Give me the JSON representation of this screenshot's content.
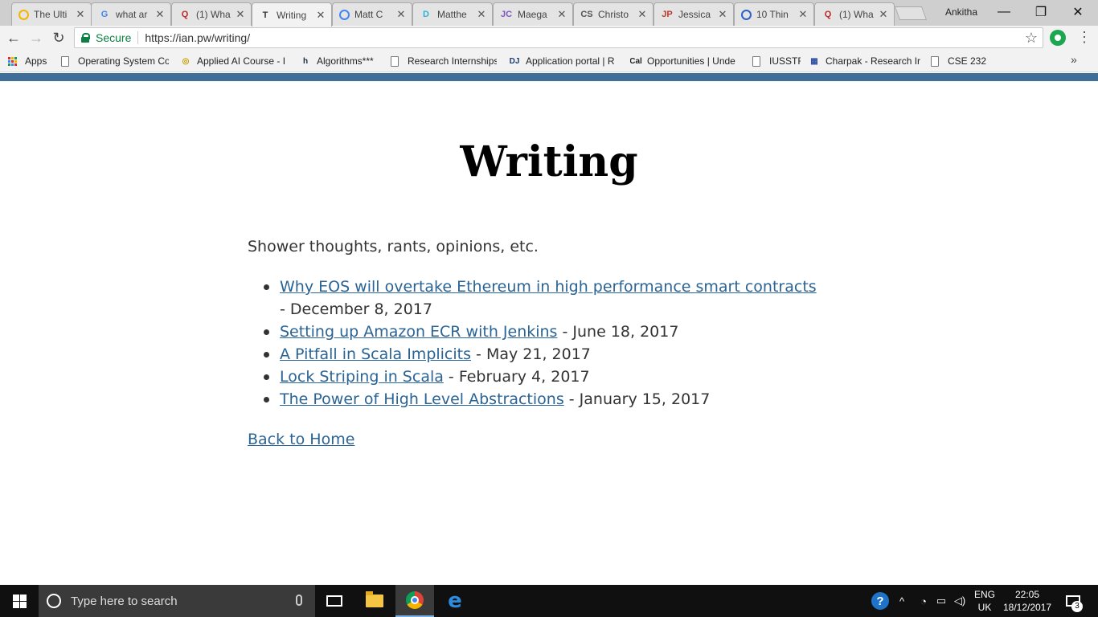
{
  "browser": {
    "tabs": [
      {
        "title": "The Ulti",
        "favicon": "slides-icon",
        "favicon_text": "",
        "favicon_color": "#f4b400"
      },
      {
        "title": "what ar",
        "favicon": "google-icon",
        "favicon_text": "G",
        "favicon_color": "#4285f4"
      },
      {
        "title": "(1) Wha",
        "favicon": "quora-icon",
        "favicon_text": "Q",
        "favicon_color": "#b92b27"
      },
      {
        "title": "Writing",
        "favicon": "writing-icon",
        "favicon_text": "T",
        "favicon_color": "#333333",
        "active": true
      },
      {
        "title": "Matt C",
        "favicon": "loading-icon",
        "favicon_text": "",
        "favicon_color": "#4285f4"
      },
      {
        "title": "Matthe",
        "favicon": "d-icon",
        "favicon_text": "D",
        "favicon_color": "#29b6d6"
      },
      {
        "title": "Maega",
        "favicon": "jc-icon",
        "favicon_text": "JC",
        "favicon_color": "#7e57c2"
      },
      {
        "title": "Christo",
        "favicon": "cs-icon",
        "favicon_text": "CS",
        "favicon_color": "#555555"
      },
      {
        "title": "Jessica",
        "favicon": "jp-icon",
        "favicon_text": "JP",
        "favicon_color": "#c0392b"
      },
      {
        "title": "10 Thin",
        "favicon": "globe-icon",
        "favicon_text": "",
        "favicon_color": "#2a62c9"
      },
      {
        "title": "(1) Wha",
        "favicon": "quora-icon",
        "favicon_text": "Q",
        "favicon_color": "#b92b27"
      }
    ],
    "profile_name": "Ankitha",
    "window_controls": {
      "minimize": "—",
      "restore": "❐",
      "close": "✕"
    },
    "secure_label": "Secure",
    "url": "https://ian.pw/writing/",
    "nav": {
      "back": "←",
      "forward": "→",
      "reload": "↻"
    },
    "star": "☆",
    "menu": "⋮"
  },
  "bookmarks": [
    {
      "label": "Apps",
      "icon": "apps-grid-icon"
    },
    {
      "label": "Operating System Co",
      "icon": "doc-icon"
    },
    {
      "label": "Applied AI Course - I",
      "icon": "course-icon",
      "icon_text": "◎",
      "icon_color": "#c8a000"
    },
    {
      "label": "Algorithms***",
      "icon": "h-icon",
      "icon_text": "h",
      "icon_color": "#1f2a44"
    },
    {
      "label": "Research Internships",
      "icon": "doc-icon"
    },
    {
      "label": "Application portal | R",
      "icon": "dj-icon",
      "icon_text": "DJ",
      "icon_color": "#1b3b6f"
    },
    {
      "label": "Opportunities | Unde",
      "icon": "cal-icon",
      "icon_text": "Cal",
      "icon_color": "#222222"
    },
    {
      "label": "IUSSTF",
      "icon": "doc-icon"
    },
    {
      "label": "Charpak - Research Ir",
      "icon": "charpak-icon",
      "icon_text": "▦",
      "icon_color": "#2d4ea0"
    },
    {
      "label": "CSE 232",
      "icon": "doc-icon"
    }
  ],
  "bookmarks_overflow": "»",
  "page": {
    "title": "Writing",
    "intro": "Shower thoughts, rants, opinions, etc.",
    "posts": [
      {
        "title": "Why EOS will overtake Ethereum in high performance smart contracts",
        "date": " - December 8, 2017"
      },
      {
        "title": "Setting up Amazon ECR with Jenkins",
        "date": " - June 18, 2017"
      },
      {
        "title": "A Pitfall in Scala Implicits",
        "date": " - May 21, 2017"
      },
      {
        "title": "Lock Striping in Scala",
        "date": " - February 4, 2017"
      },
      {
        "title": "The Power of High Level Abstractions",
        "date": " - January 15, 2017"
      }
    ],
    "back_link": "Back to Home",
    "accent_color": "#3f6f98",
    "link_color": "#2a6496"
  },
  "taskbar": {
    "search_placeholder": "Type here to search",
    "language": "ENG",
    "region": "UK",
    "time": "22:05",
    "date": "18/12/2017",
    "notification_count": "3",
    "help_glyph": "?",
    "tray_up": "^",
    "wifi_glyph": "◔",
    "battery_glyph": "▭",
    "volume_glyph": "◁)"
  }
}
